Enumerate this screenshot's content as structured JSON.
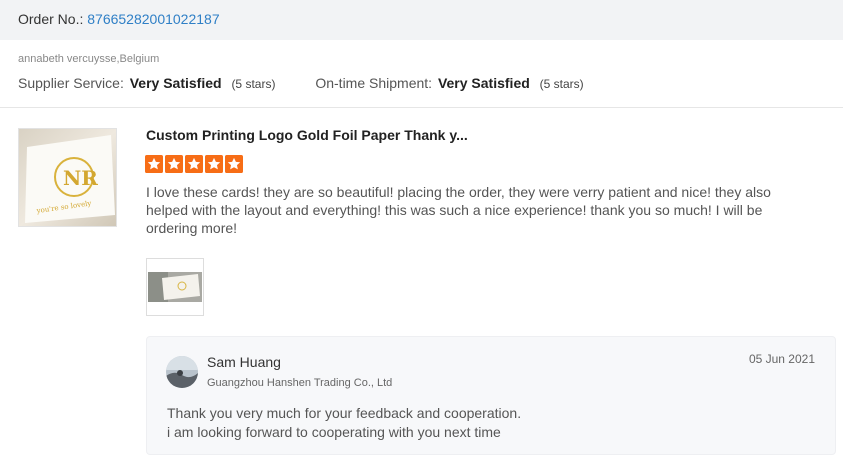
{
  "order": {
    "label": "Order No.: ",
    "number": "87665282001022187"
  },
  "buyer": {
    "name_location": "annabeth vercuysse,Belgium"
  },
  "ratings": {
    "supplier_service_label": "Supplier Service:",
    "supplier_service_value": "Very Satisfied",
    "supplier_service_stars": "(5 stars)",
    "shipment_label": "On-time Shipment:",
    "shipment_value": "Very Satisfied",
    "shipment_stars": "(5 stars)"
  },
  "review": {
    "product_title": "Custom Printing Logo Gold Foil Paper Thank y...",
    "rating": 5,
    "star_color": "#f76d16",
    "text": "I love these cards! they are so beautiful! placing the order, they were verry patient and nice! they also helped with the layout and everything! this was such a nice experience! thank you so much! I will be ordering more!"
  },
  "reply": {
    "seller_name": "Sam Huang",
    "company": "Guangzhou Hanshen Trading Co., Ltd",
    "date": "05 Jun 2021",
    "line1": "Thank you very much for your feedback and cooperation.",
    "line2": "i am looking forward to cooperating with you next time"
  },
  "colors": {
    "link_blue": "#2f7fc6",
    "header_bg": "#f2f3f5",
    "reply_bg": "#f7f8fa"
  }
}
